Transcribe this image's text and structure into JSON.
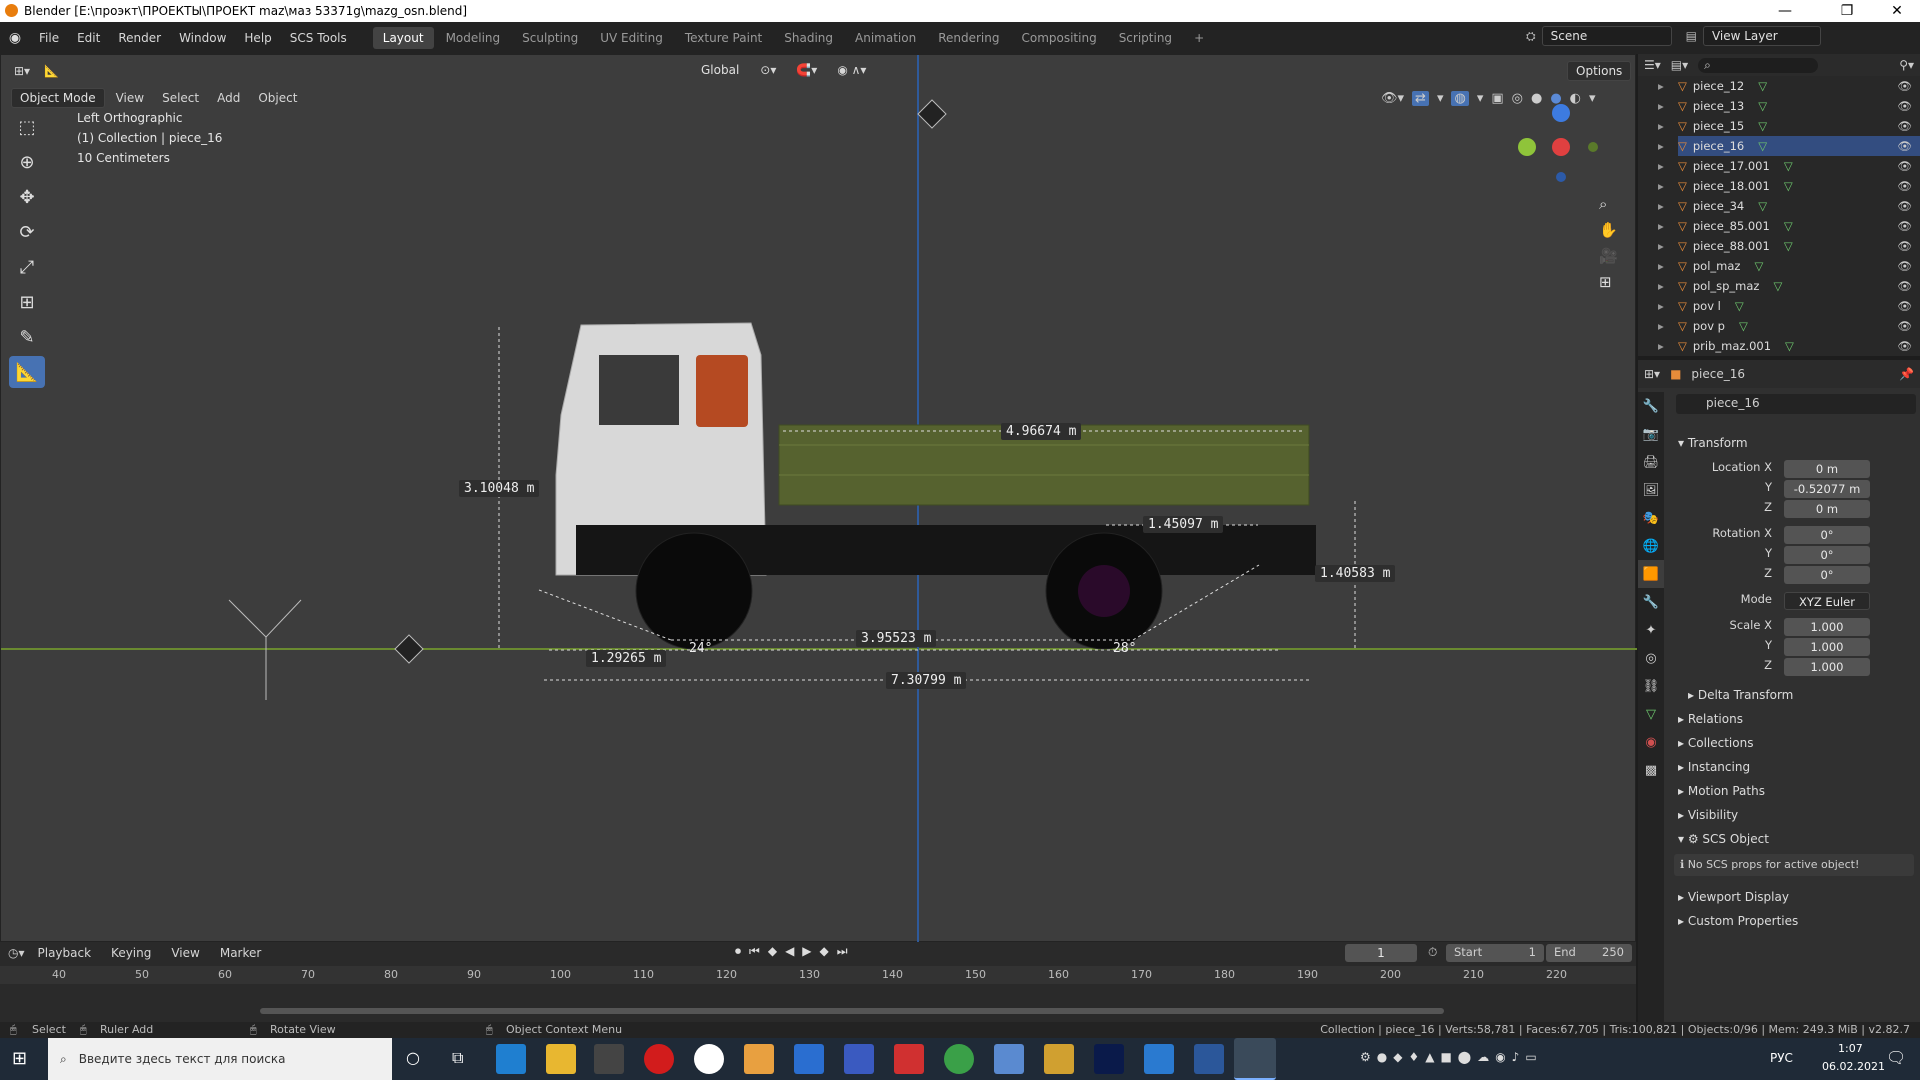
{
  "window": {
    "title": "Blender [E:\\проэкт\\ПРОЕКТЫ\\ПРОЕКТ maz\\маз 53371g\\mazg_osn.blend]"
  },
  "menu": [
    "File",
    "Edit",
    "Render",
    "Window",
    "Help",
    "SCS Tools"
  ],
  "workspaces": [
    "Layout",
    "Modeling",
    "Sculpting",
    "UV Editing",
    "Texture Paint",
    "Shading",
    "Animation",
    "Rendering",
    "Compositing",
    "Scripting"
  ],
  "active_workspace": "Layout",
  "scene": "Scene",
  "view_layer": "View Layer",
  "viewport": {
    "mode": "Object Mode",
    "menu": [
      "View",
      "Select",
      "Add",
      "Object"
    ],
    "orientation": "Global",
    "options": "Options",
    "overlay": {
      "view": "Left Orthographic",
      "collection": "(1) Collection | piece_16",
      "scale": "10 Centimeters"
    },
    "measurements": {
      "m1": "3.10048 m",
      "m2": "4.96674 m",
      "m3": "1.45097 m",
      "m4": "1.40583 m",
      "m5": "3.95523 m",
      "m6": "1.29265 m",
      "m7": "7.30799 m",
      "a1": "24°",
      "a2": "28°"
    }
  },
  "outliner": {
    "items": [
      {
        "name": "piece_12",
        "sel": false
      },
      {
        "name": "piece_13",
        "sel": false
      },
      {
        "name": "piece_15",
        "sel": false
      },
      {
        "name": "piece_16",
        "sel": true
      },
      {
        "name": "piece_17.001",
        "sel": false
      },
      {
        "name": "piece_18.001",
        "sel": false
      },
      {
        "name": "piece_34",
        "sel": false
      },
      {
        "name": "piece_85.001",
        "sel": false
      },
      {
        "name": "piece_88.001",
        "sel": false
      },
      {
        "name": "pol_maz",
        "sel": false
      },
      {
        "name": "pol_sp_maz",
        "sel": false
      },
      {
        "name": "pov l",
        "sel": false
      },
      {
        "name": "pov p",
        "sel": false
      },
      {
        "name": "prib_maz.001",
        "sel": false
      }
    ]
  },
  "properties": {
    "object_header": "piece_16",
    "object_name": "piece_16",
    "transform_label": "Transform",
    "location_label": "Location X",
    "loc": {
      "x": "0 m",
      "y": "-0.52077 m",
      "z": "0 m"
    },
    "rotation_label": "Rotation X",
    "rot": {
      "x": "0°",
      "y": "0°",
      "z": "0°"
    },
    "mode_label": "Mode",
    "mode": "XYZ Euler",
    "scale_label": "Scale X",
    "scale": {
      "x": "1.000",
      "y": "1.000",
      "z": "1.000"
    },
    "axis_y": "Y",
    "axis_z": "Z",
    "sections": [
      "Delta Transform",
      "Relations",
      "Collections",
      "Instancing",
      "Motion Paths",
      "Visibility"
    ],
    "scs_object": "SCS Object",
    "scs_info": "No SCS props for active object!",
    "sections2": [
      "Viewport Display",
      "Custom Properties"
    ]
  },
  "timeline": {
    "menu": [
      "Playback",
      "Keying",
      "View",
      "Marker"
    ],
    "current_frame": "1",
    "start_label": "Start",
    "start": "1",
    "end_label": "End",
    "end": "250",
    "ruler": [
      "40",
      "50",
      "60",
      "70",
      "80",
      "90",
      "100",
      "110",
      "120",
      "130",
      "140",
      "150",
      "160",
      "170",
      "180",
      "190",
      "200",
      "210",
      "220"
    ]
  },
  "status": {
    "select": "Select",
    "ruler_add": "Ruler Add",
    "rotate_view": "Rotate View",
    "context_menu": "Object Context Menu",
    "stats": "Collection | piece_16 | Verts:58,781 | Faces:67,705 | Tris:100,821 | Objects:0/96 | Mem: 249.3 MiB | v2.82.7"
  },
  "taskbar": {
    "search_placeholder": "Введите здесь текст для поиска",
    "lang": "РУС",
    "time": "1:07",
    "date": "06.02.2021"
  }
}
